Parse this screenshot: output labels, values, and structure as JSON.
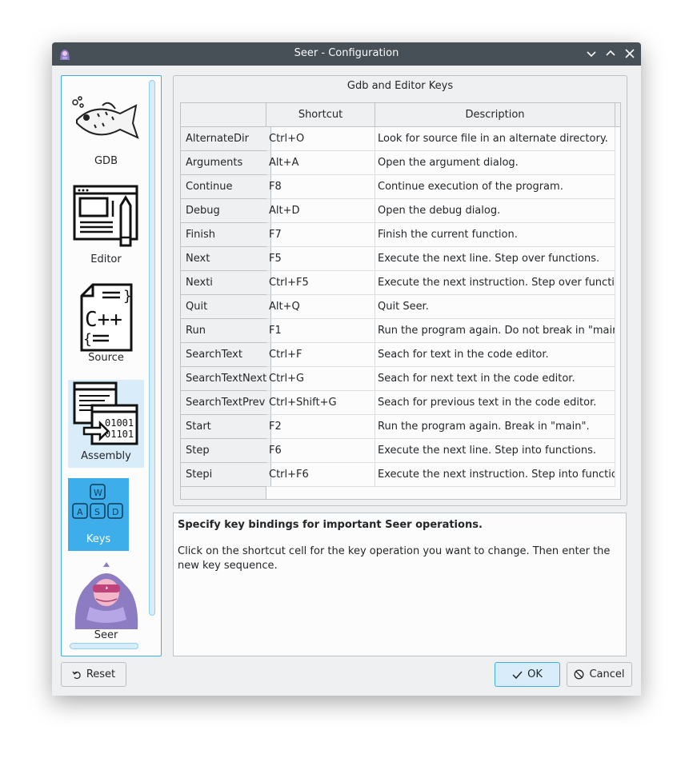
{
  "window": {
    "title": "Seer - Configuration"
  },
  "sidebar": {
    "items": [
      {
        "label": "GDB",
        "icon": "fish-icon"
      },
      {
        "label": "Editor",
        "icon": "editor-icon"
      },
      {
        "label": "Source",
        "icon": "cpp-source-icon"
      },
      {
        "label": "Assembly",
        "icon": "assembly-icon"
      },
      {
        "label": "Keys",
        "icon": "keyboard-wasd-icon"
      },
      {
        "label": "Seer",
        "icon": "hooded-seer-icon"
      }
    ],
    "active": "Keys",
    "hovered": "Assembly"
  },
  "keys_panel": {
    "group_title": "Gdb and Editor Keys",
    "columns": [
      "Shortcut",
      "Description"
    ],
    "rows": [
      {
        "key": "AlternateDir",
        "shortcut": "Ctrl+O",
        "description": "Look for source file in an alternate directory."
      },
      {
        "key": "Arguments",
        "shortcut": "Alt+A",
        "description": "Open the argument dialog."
      },
      {
        "key": "Continue",
        "shortcut": "F8",
        "description": "Continue execution of the program."
      },
      {
        "key": "Debug",
        "shortcut": "Alt+D",
        "description": "Open the debug dialog."
      },
      {
        "key": "Finish",
        "shortcut": "F7",
        "description": "Finish the current function."
      },
      {
        "key": "Next",
        "shortcut": "F5",
        "description": "Execute the next line. Step over functions."
      },
      {
        "key": "Nexti",
        "shortcut": "Ctrl+F5",
        "description": "Execute the next instruction. Step over functions."
      },
      {
        "key": "Quit",
        "shortcut": "Alt+Q",
        "description": "Quit Seer."
      },
      {
        "key": "Run",
        "shortcut": "F1",
        "description": "Run the program again. Do not break in \"main\"."
      },
      {
        "key": "SearchText",
        "shortcut": "Ctrl+F",
        "description": "Seach for text in the code editor."
      },
      {
        "key": "SearchTextNext",
        "shortcut": "Ctrl+G",
        "description": "Seach for next text in the code editor."
      },
      {
        "key": "SearchTextPrev",
        "shortcut": "Ctrl+Shift+G",
        "description": "Seach for previous text in the code editor."
      },
      {
        "key": "Start",
        "shortcut": "F2",
        "description": "Run the program again. Break in \"main\"."
      },
      {
        "key": "Step",
        "shortcut": "F6",
        "description": "Execute the next line. Step into functions."
      },
      {
        "key": "Stepi",
        "shortcut": "Ctrl+F6",
        "description": "Execute the next instruction. Step into functions."
      }
    ]
  },
  "help": {
    "title": "Specify key bindings for important Seer operations.",
    "body": "Click on the shortcut cell for the key operation you want to change. Then enter the new key sequence."
  },
  "buttons": {
    "reset": "Reset",
    "ok": "OK",
    "cancel": "Cancel"
  },
  "colors": {
    "accent": "#3daee9",
    "titlebar": "#475057",
    "selection": "#d8ecf9"
  }
}
